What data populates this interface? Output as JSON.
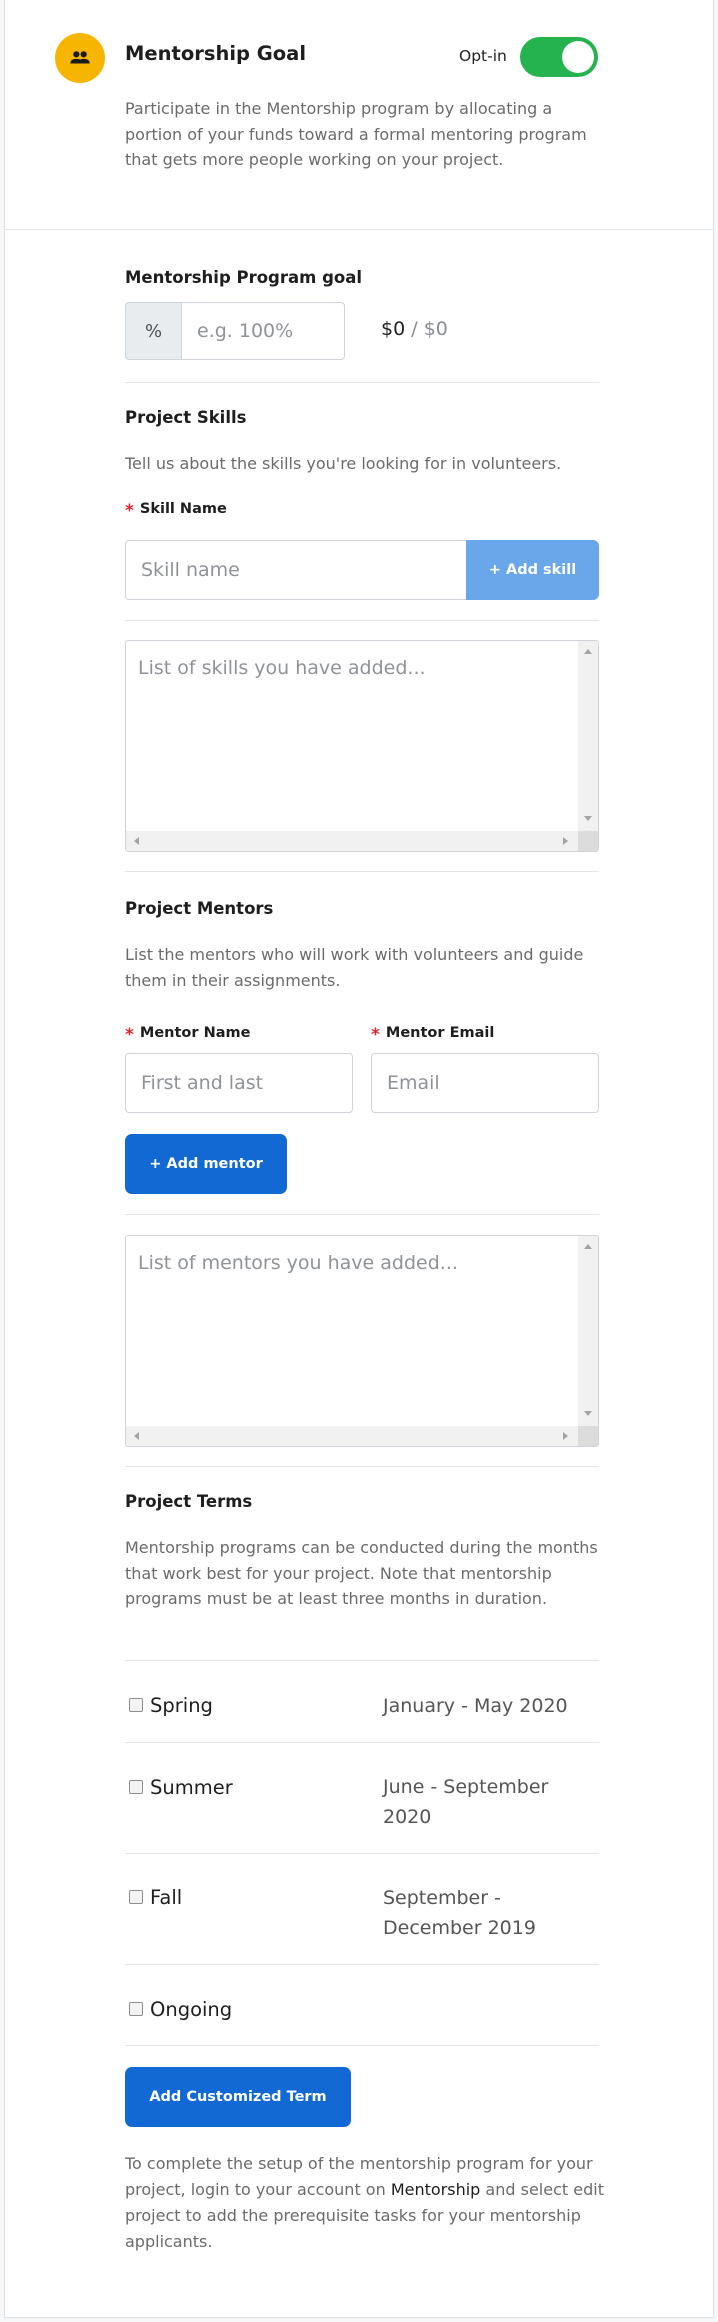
{
  "header": {
    "title": "Mentorship Goal",
    "optin_label": "Opt-in",
    "optin_enabled": true,
    "description": "Participate in the Mentorship program by allocating a portion of your funds toward a formal mentoring program that gets more people working on your project.",
    "avatar_icon": "group-icon",
    "accent_color": "#f6b500",
    "toggle_color": "#24b34f"
  },
  "goal": {
    "title": "Mentorship Program goal",
    "addon": "%",
    "placeholder": "e.g. 100%",
    "raised": "$0",
    "separator": "/",
    "target": "$0"
  },
  "skills": {
    "title": "Project Skills",
    "description": "Tell us about the skills you're looking for in volunteers.",
    "field_label": "Skill Name",
    "placeholder": "Skill name",
    "add_button": "+ Add skill",
    "list_placeholder": "List of skills you have added..."
  },
  "mentors": {
    "title": "Project Mentors",
    "description": "List the mentors who will work with volunteers and guide them in their assignments.",
    "name_label": "Mentor Name",
    "name_placeholder": "First and last",
    "email_label": "Mentor Email",
    "email_placeholder": "Email",
    "add_button": "+ Add mentor",
    "list_placeholder": "List of mentors you have added..."
  },
  "terms": {
    "title": "Project Terms",
    "description": "Mentorship programs can be conducted during the months that work best for your project. Note that mentorship programs must be at least three months in duration.",
    "items": [
      {
        "name": "Spring",
        "dates": "January - May 2020",
        "checked": false
      },
      {
        "name": "Summer",
        "dates": "June - September 2020",
        "checked": false
      },
      {
        "name": "Fall",
        "dates": "September - December 2019",
        "checked": false
      },
      {
        "name": "Ongoing",
        "dates": "",
        "checked": false
      }
    ],
    "add_button": "Add Customized Term"
  },
  "footer": {
    "text_before": "To complete the setup of the mentorship program for your project, login to your account on ",
    "link": "Mentorship",
    "text_after": " and select edit project to add the prerequisite tasks for your mentorship applicants."
  }
}
